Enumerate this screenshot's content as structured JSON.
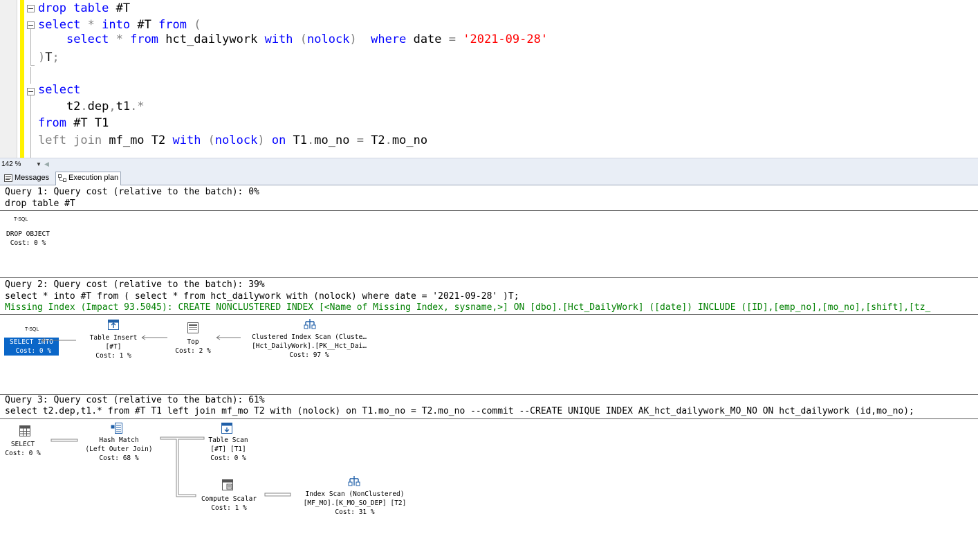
{
  "editor": {
    "lines": [
      {
        "parts": [
          [
            "kw",
            "drop table "
          ],
          [
            "plain",
            "#T"
          ]
        ]
      },
      {
        "parts": [
          [
            "kw",
            "select "
          ],
          [
            "op",
            "* "
          ],
          [
            "kw",
            "into "
          ],
          [
            "plain",
            "#T "
          ],
          [
            "kw",
            "from "
          ],
          [
            "op",
            "("
          ]
        ]
      },
      {
        "parts": [
          [
            "plain",
            "    "
          ],
          [
            "kw",
            "select "
          ],
          [
            "op",
            "* "
          ],
          [
            "kw",
            "from "
          ],
          [
            "plain",
            "hct_dailywork "
          ],
          [
            "kw",
            "with "
          ],
          [
            "op",
            "("
          ],
          [
            "kw",
            "nolock"
          ],
          [
            "op",
            ")  "
          ],
          [
            "kw",
            "where "
          ],
          [
            "plain",
            "date "
          ],
          [
            "op",
            "= "
          ],
          [
            "str",
            "'2021-09-28'"
          ]
        ]
      },
      {
        "parts": [
          [
            "op",
            ")"
          ],
          [
            "plain",
            "T"
          ],
          [
            "op",
            ";"
          ]
        ]
      },
      {
        "parts": []
      },
      {
        "parts": [
          [
            "kw",
            "select"
          ]
        ]
      },
      {
        "parts": [
          [
            "plain",
            "    t2"
          ],
          [
            "op",
            "."
          ],
          [
            "plain",
            "dep"
          ],
          [
            "op",
            ","
          ],
          [
            "plain",
            "t1"
          ],
          [
            "op",
            ".*"
          ]
        ]
      },
      {
        "parts": [
          [
            "kw",
            "from "
          ],
          [
            "plain",
            "#T T1"
          ]
        ]
      },
      {
        "parts": [
          [
            "grey",
            "left join "
          ],
          [
            "plain",
            "mf_mo T2 "
          ],
          [
            "kw",
            "with "
          ],
          [
            "op",
            "("
          ],
          [
            "kw",
            "nolock"
          ],
          [
            "op",
            ") "
          ],
          [
            "kw",
            "on "
          ],
          [
            "plain",
            "T1"
          ],
          [
            "op",
            "."
          ],
          [
            "plain",
            "mo_no "
          ],
          [
            "op",
            "= "
          ],
          [
            "plain",
            "T2"
          ],
          [
            "op",
            "."
          ],
          [
            "plain",
            "mo_no"
          ]
        ]
      }
    ]
  },
  "zoom": {
    "value": "142 %",
    "arrow": "▼",
    "scroll_left": "◀"
  },
  "tabs": {
    "messages": "Messages",
    "plan": "Execution plan"
  },
  "queries": {
    "q1": {
      "header": "Query 1: Query cost (relative to the batch): 0%",
      "sql": "drop table #T",
      "tsql": "T-SQL",
      "node": {
        "label": "DROP OBJECT",
        "cost": " Cost: 0 %"
      }
    },
    "q2": {
      "header": "Query 2: Query cost (relative to the batch): 39%",
      "sql": "select * into #T from ( select * from hct_dailywork with (nolock) where date = '2021-09-28' )T;",
      "missing": "Missing Index (Impact 93.5045): CREATE NONCLUSTERED INDEX [<Name of Missing Index, sysname,>] ON [dbo].[Hct_DailyWork] ([date]) INCLUDE ([ID],[emp_no],[mo_no],[shift],[tz_",
      "tsql": "T-SQL",
      "select_into": {
        "label": "SELECT INTO",
        "cost": " Cost: 0 %"
      },
      "table_insert": {
        "label": "Table Insert",
        "sub": "[#T]",
        "cost": "Cost: 1 %"
      },
      "top": {
        "label": "Top",
        "cost": "Cost: 2 %"
      },
      "clustered_scan": {
        "label": "Clustered Index Scan (Cluste…",
        "sub": "[Hct_DailyWork].[PK__Hct_Dai…",
        "cost": "Cost: 97 %"
      }
    },
    "q3": {
      "header": "Query 3: Query cost (relative to the batch): 61%",
      "sql": "select t2.dep,t1.* from #T T1 left join mf_mo T2 with (nolock) on T1.mo_no = T2.mo_no --commit --CREATE UNIQUE INDEX AK_hct_dailywork_MO_NO ON hct_dailywork (id,mo_no);",
      "select": {
        "label": "SELECT",
        "cost": "Cost: 0 %"
      },
      "hash_match": {
        "label": "Hash Match",
        "sub": "(Left Outer Join)",
        "cost": "Cost: 68 %"
      },
      "table_scan": {
        "label": "Table Scan",
        "sub": "[#T] [T1]",
        "cost": "Cost: 0 %"
      },
      "compute_scalar": {
        "label": "Compute Scalar",
        "cost": "Cost: 1 %"
      },
      "index_scan": {
        "label": "Index Scan (NonClustered)",
        "sub": "[MF_MO].[K_MO_SO_DEP] [T2]",
        "cost": "Cost: 31 %"
      }
    }
  },
  "colors": {
    "keyword": "#0000ff",
    "string": "#ff0000",
    "operator": "#808080",
    "missing_index": "#008000",
    "selected_node": "#0a66c8",
    "change_bar": "#fff200"
  }
}
